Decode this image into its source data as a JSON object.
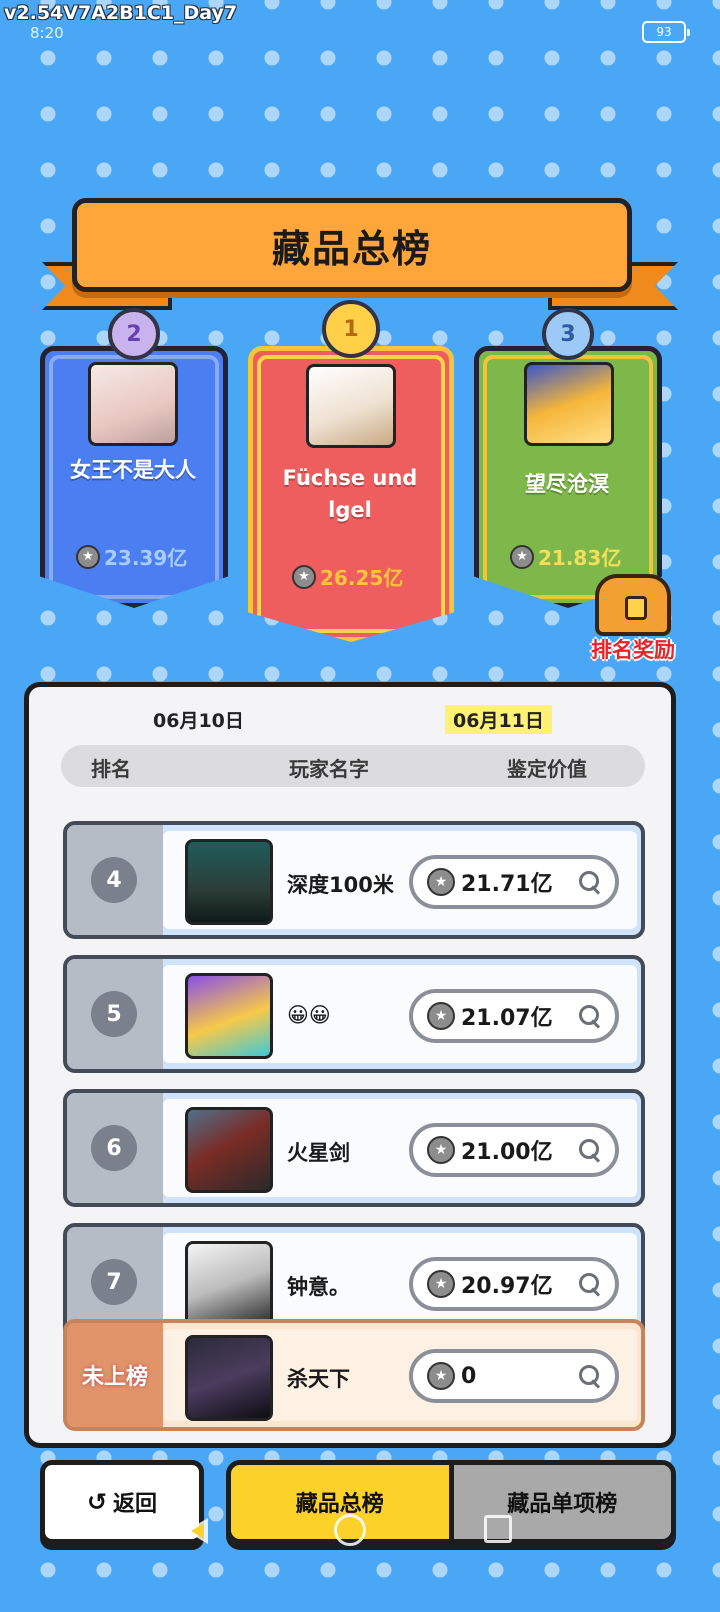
{
  "status": {
    "build_tag": "v2.54V7A2B1C1_Day7",
    "time": "8:20",
    "battery": "93"
  },
  "title": "藏品总榜",
  "podium": {
    "first": {
      "rank": "1",
      "name": "Füchse und lgel",
      "value": "26.25亿"
    },
    "second": {
      "rank": "2",
      "name": "女王不是大人",
      "value": "23.39亿"
    },
    "third": {
      "rank": "3",
      "name": "望尽沧溟",
      "value": "21.83亿"
    }
  },
  "reward_label": "排名奖励",
  "dates": {
    "previous": "06月10日",
    "current": "06月11日"
  },
  "columns": {
    "rank": "排名",
    "player": "玩家名字",
    "value": "鉴定价值"
  },
  "rows": [
    {
      "rank": "4",
      "name": "深度100米",
      "value": "21.71亿"
    },
    {
      "rank": "5",
      "name": "😀😀",
      "value": "21.07亿"
    },
    {
      "rank": "6",
      "name": "火星剑",
      "value": "21.00亿"
    },
    {
      "rank": "7",
      "name": "钟意。",
      "value": "20.97亿"
    }
  ],
  "me": {
    "rank": "未上榜",
    "name": "杀天下",
    "value": "0"
  },
  "nav": {
    "back": "返回",
    "tab_total": "藏品总榜",
    "tab_single": "藏品单项榜"
  },
  "icons": {
    "coin": "coin-icon",
    "search": "magnifier-icon",
    "chest": "treasure-chest-icon",
    "back": "undo-arrow-icon"
  },
  "colors": {
    "background": "#4aa7f5",
    "banner": "#ffa63a",
    "first_card": "#ee5e5e",
    "second_card": "#4b7ef0",
    "third_card": "#7fb84a",
    "active_tab": "#fbd12a",
    "reward_text": "#e8232a"
  }
}
